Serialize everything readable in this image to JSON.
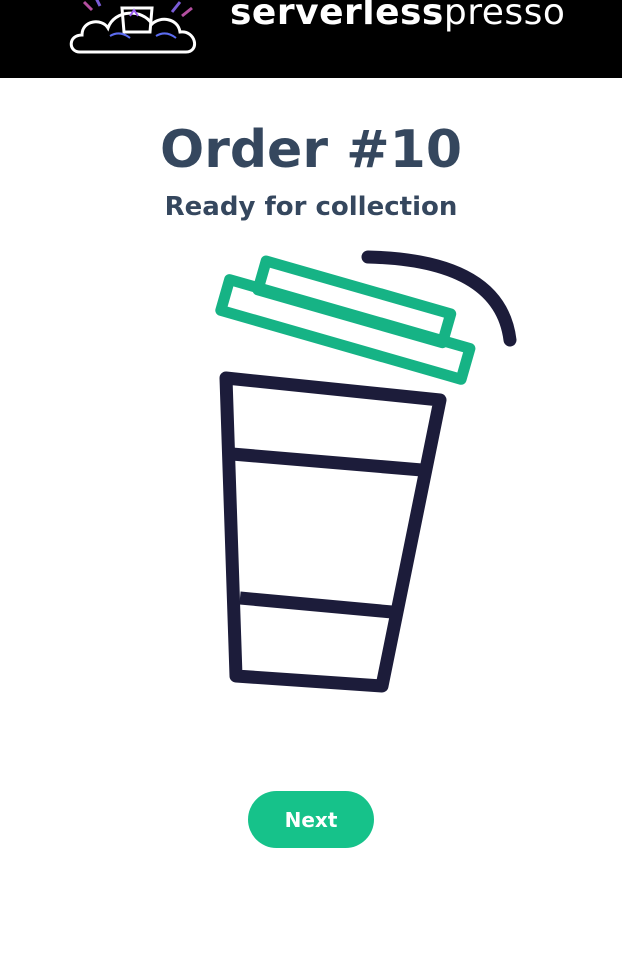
{
  "header": {
    "brand_bold": "serverless",
    "brand_light": "presso"
  },
  "order": {
    "title": "Order #10",
    "status": "Ready for collection"
  },
  "actions": {
    "next_label": "Next"
  },
  "colors": {
    "header_bg": "#000000",
    "title": "#35475e",
    "cup_outline": "#1c1c3a",
    "lid": "#16b385",
    "button": "#16c28a"
  },
  "icons": {
    "logo": "serverlesspresso-cloud-logo",
    "illustration": "coffee-cup-icon"
  }
}
